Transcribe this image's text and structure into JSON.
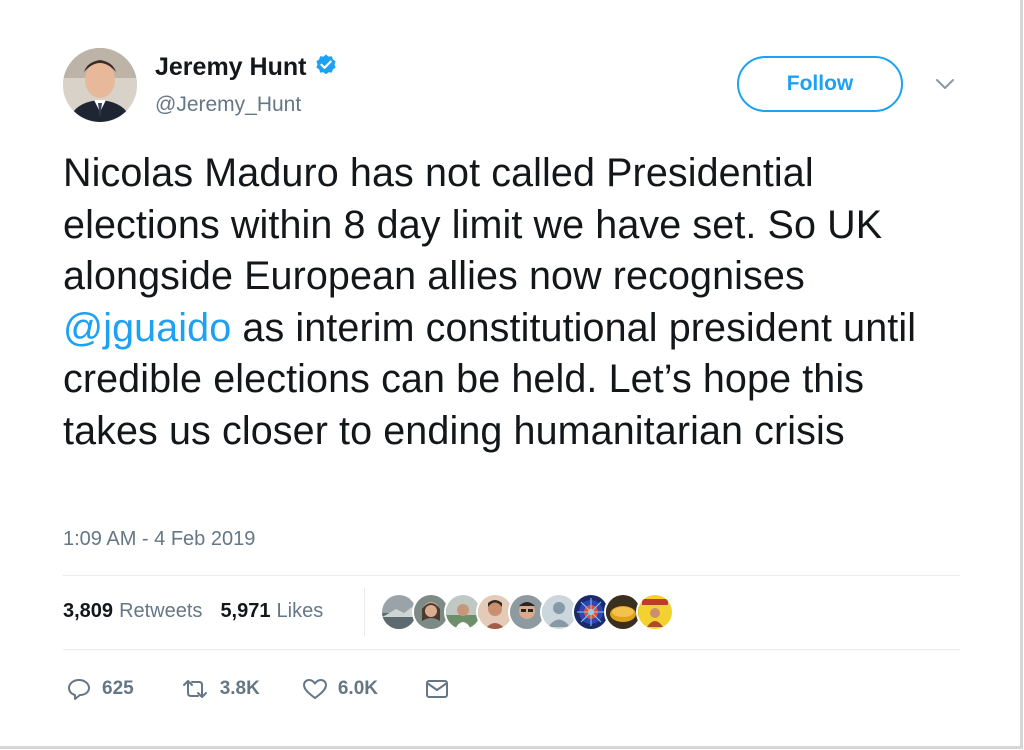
{
  "author": {
    "name": "Jeremy Hunt",
    "handle": "@Jeremy_Hunt"
  },
  "follow_label": "Follow",
  "tweet": {
    "part1": "Nicolas Maduro has not called Presidential elections within 8 day limit we have set. So UK alongside European allies now recognises ",
    "mention": "@jguaido",
    "part2": " as interim constitutional president until credible elections can be held. Let’s hope this takes us closer to ending humanitarian crisis"
  },
  "timestamp": "1:09 AM - 4 Feb 2019",
  "stats": {
    "retweets_count": "3,809",
    "retweets_label": "Retweets",
    "likes_count": "5,971",
    "likes_label": "Likes"
  },
  "actions": {
    "reply_count": "625",
    "retweet_count": "3.8K",
    "like_count": "6.0K"
  },
  "colors": {
    "accent": "#1da1f2",
    "secondary_text": "#657786",
    "primary_text": "#14171a"
  },
  "icons": [
    "verified-badge-icon",
    "chevron-down-icon",
    "reply-icon",
    "retweet-icon",
    "like-icon",
    "message-icon"
  ]
}
